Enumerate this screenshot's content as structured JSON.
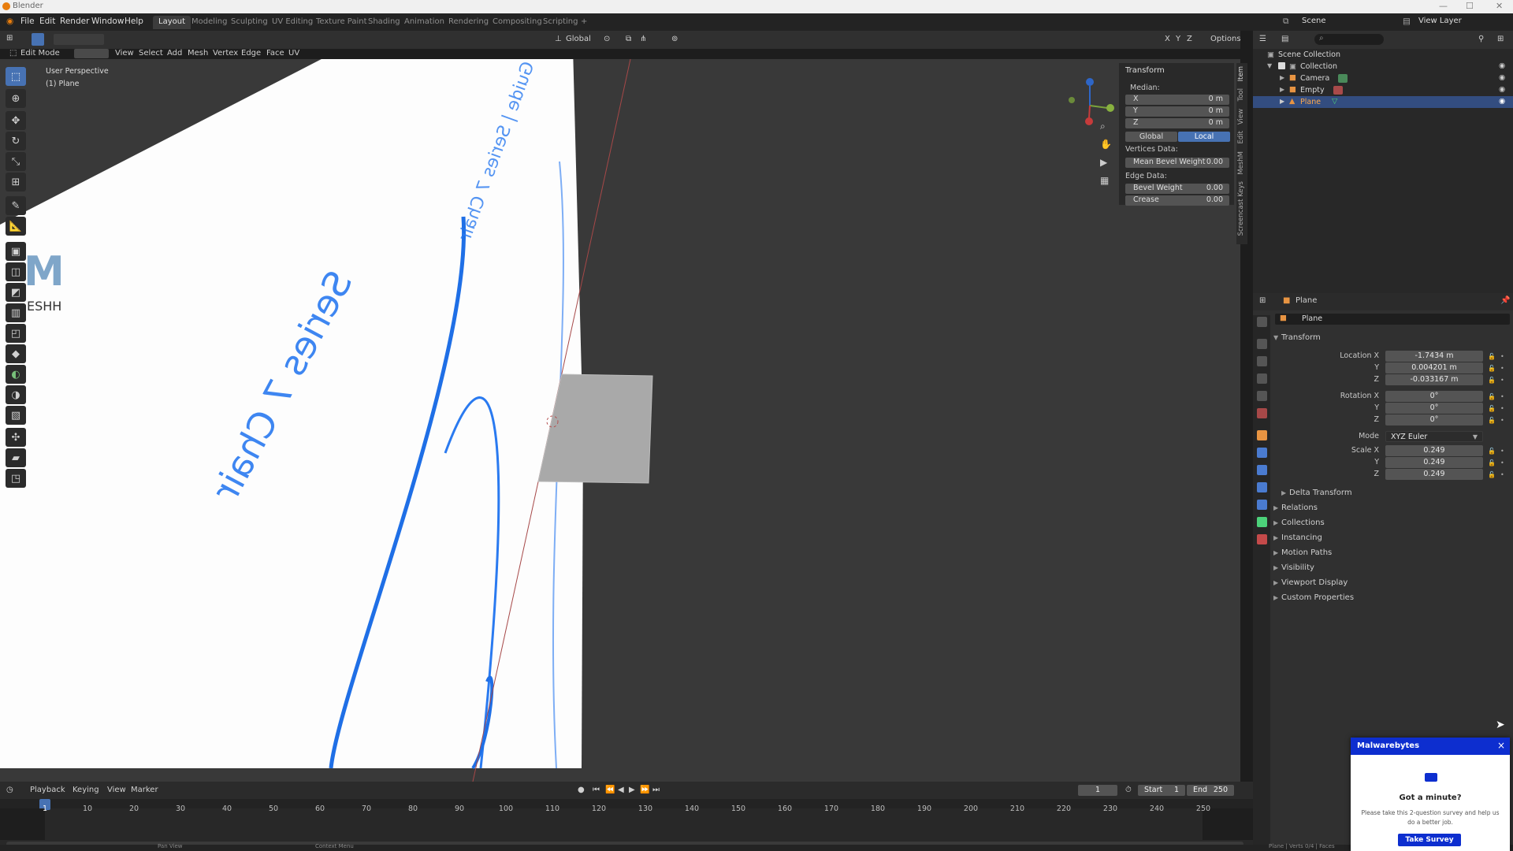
{
  "window": {
    "title": "Blender"
  },
  "menu": {
    "items": [
      "File",
      "Edit",
      "Render",
      "Window",
      "Help"
    ],
    "workspaces": [
      "Layout",
      "Modeling",
      "Sculpting",
      "UV Editing",
      "Texture Paint",
      "Shading",
      "Animation",
      "Rendering",
      "Compositing",
      "Scripting"
    ],
    "active_workspace": "Layout",
    "add_tab": "+",
    "scene_label": "Scene",
    "view_layer_label": "View Layer"
  },
  "viewport_header": {
    "mode": "Edit Mode",
    "menus": [
      "View",
      "Select",
      "Add",
      "Mesh",
      "Vertex",
      "Edge",
      "Face",
      "UV"
    ],
    "orientation": "Global",
    "options": "Options",
    "axes": [
      "X",
      "Y",
      "Z"
    ]
  },
  "viewport": {
    "perspective": "User Perspective",
    "object_label": "(1) Plane",
    "image_text": "Series 7 Chair",
    "image_text_small": "Guide | Series 7 Chair",
    "watermark": "M",
    "watermark_sub": "ESHH"
  },
  "npanel": {
    "section": "Transform",
    "median_label": "Median:",
    "fields": [
      {
        "label": "X",
        "value": "0 m"
      },
      {
        "label": "Y",
        "value": "0 m"
      },
      {
        "label": "Z",
        "value": "0 m"
      }
    ],
    "global_label": "Global",
    "local_label": "Local",
    "vertices_data_label": "Vertices Data:",
    "mean_bevel_label": "Mean Bevel Weight",
    "mean_bevel_value": "0.00",
    "edge_data_label": "Edge Data:",
    "bevel_weight_label": "Bevel Weight",
    "bevel_weight_value": "0.00",
    "crease_label": "Crease",
    "crease_value": "0.00",
    "side_tabs": [
      "Item",
      "Tool",
      "View",
      "Edit",
      "MeshM",
      "Screencast Keys"
    ]
  },
  "outliner": {
    "search_placeholder": "",
    "rows": [
      {
        "label": "Scene Collection"
      },
      {
        "label": "Collection"
      },
      {
        "label": "Camera"
      },
      {
        "label": "Empty"
      },
      {
        "label": "Plane"
      }
    ]
  },
  "properties": {
    "object_name_header": "Plane",
    "object_name_field": "Plane",
    "transform_label": "Transform",
    "location_x_label": "Location X",
    "location": [
      "-1.7434 m",
      "0.004201 m",
      "-0.033167 m"
    ],
    "rotation_x_label": "Rotation X",
    "rotation": [
      "0°",
      "0°",
      "0°"
    ],
    "mode_label": "Mode",
    "mode_value": "XYZ Euler",
    "scale_x_label": "Scale X",
    "scale": [
      "0.249",
      "0.249",
      "0.249"
    ],
    "y_label": "Y",
    "z_label": "Z",
    "delta_transform": "Delta Transform",
    "subpanels": [
      "Relations",
      "Collections",
      "Instancing",
      "Motion Paths",
      "Visibility",
      "Viewport Display",
      "Custom Properties"
    ]
  },
  "timeline": {
    "menus": [
      "Playback",
      "Keying",
      "View",
      "Marker"
    ],
    "current_frame": "1",
    "start_label": "Start",
    "start_value": "1",
    "end_label": "End",
    "end_value": "250",
    "ticks": [
      "1",
      "10",
      "20",
      "30",
      "40",
      "50",
      "60",
      "70",
      "80",
      "90",
      "100",
      "110",
      "120",
      "130",
      "140",
      "150",
      "160",
      "170",
      "180",
      "190",
      "200",
      "210",
      "220",
      "230",
      "240",
      "250"
    ]
  },
  "status_bar": {
    "left": "Pan View",
    "mid": "Context Menu",
    "right": "Plane | Verts 0/4 | Faces"
  },
  "popup": {
    "brand": "Malwarebytes",
    "close": "×",
    "heading": "Got a minute?",
    "body": "Please take this 2-question survey and help us do a better job.",
    "button": "Take Survey"
  },
  "colors": {
    "accent": "#4772b3",
    "selection": "#334d80",
    "popup_brand": "#0d2ecf",
    "image_blue": "#1f6fe6"
  }
}
